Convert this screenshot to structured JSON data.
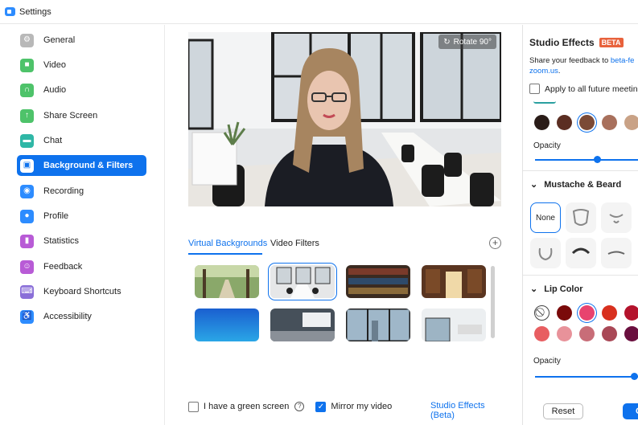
{
  "window": {
    "title": "Settings"
  },
  "sidebar": {
    "items": [
      {
        "label": "General",
        "icon": "gear-icon",
        "color": "#b8b8b8",
        "glyph": "⚙"
      },
      {
        "label": "Video",
        "icon": "video-camera-icon",
        "color": "#4ec36a",
        "glyph": "■"
      },
      {
        "label": "Audio",
        "icon": "headphones-icon",
        "color": "#4ec36a",
        "glyph": "∩"
      },
      {
        "label": "Share Screen",
        "icon": "share-screen-icon",
        "color": "#4ec36a",
        "glyph": "↑"
      },
      {
        "label": "Chat",
        "icon": "chat-bubble-icon",
        "color": "#2fb7a6",
        "glyph": "▬"
      },
      {
        "label": "Background & Filters",
        "icon": "background-icon",
        "color": "#0e72ed",
        "glyph": "▣",
        "active": true
      },
      {
        "label": "Recording",
        "icon": "record-icon",
        "color": "#2d8cff",
        "glyph": "◉"
      },
      {
        "label": "Profile",
        "icon": "profile-icon",
        "color": "#2d8cff",
        "glyph": "●"
      },
      {
        "label": "Statistics",
        "icon": "statistics-icon",
        "color": "#b85bd6",
        "glyph": "▮"
      },
      {
        "label": "Feedback",
        "icon": "feedback-icon",
        "color": "#b85bd6",
        "glyph": "☺"
      },
      {
        "label": "Keyboard Shortcuts",
        "icon": "keyboard-icon",
        "color": "#8a6fd8",
        "glyph": "⌨"
      },
      {
        "label": "Accessibility",
        "icon": "accessibility-icon",
        "color": "#2d8cff",
        "glyph": "♿"
      }
    ]
  },
  "preview": {
    "rotate_label": "Rotate 90°"
  },
  "tabs": {
    "virtual_backgrounds": "Virtual Backgrounds",
    "video_filters": "Video Filters",
    "add": "+"
  },
  "backgrounds": [
    {
      "name": "Park path",
      "selected": false
    },
    {
      "name": "Conference room",
      "selected": true
    },
    {
      "name": "Bookshelf",
      "selected": false
    },
    {
      "name": "Library hall",
      "selected": false
    },
    {
      "name": "Blue gradient",
      "selected": false
    },
    {
      "name": "Meeting room with screen",
      "selected": false
    },
    {
      "name": "City office window",
      "selected": false
    },
    {
      "name": "White office",
      "selected": false
    }
  ],
  "footer": {
    "green_screen_label": "I have a green screen",
    "help": "?",
    "mirror_label": "Mirror my video",
    "studio_effects_link": "Studio Effects (Beta)"
  },
  "studio_effects": {
    "title": "Studio Effects",
    "beta": "BETA",
    "feedback_prefix": "Share your feedback to",
    "feedback_link_1": "beta-fe",
    "feedback_link_2": "zoom.us",
    "feedback_suffix": ".",
    "apply_label": "Apply to all future meetin",
    "eyebrow_colors": [
      "#2a1c18",
      "#5b2e22",
      "#7b4a36",
      "#a8705c",
      "#c9a286"
    ],
    "opacity_label": "Opacity",
    "eyebrow_opacity": 0.6,
    "mustache_title": "Mustache & Beard",
    "none_label": "None",
    "lip_title": "Lip Color",
    "lip_colors_row1": [
      "none",
      "#7a0a0a",
      "#e8436e",
      "#d8301e",
      "#b4132c"
    ],
    "lip_colors_row2": [
      "#e85e61",
      "#e8929a",
      "#c86d78",
      "#a94856",
      "#6a0f3e"
    ],
    "lip_opacity": 0.95,
    "reset_label": "Reset",
    "close_label": "C"
  }
}
